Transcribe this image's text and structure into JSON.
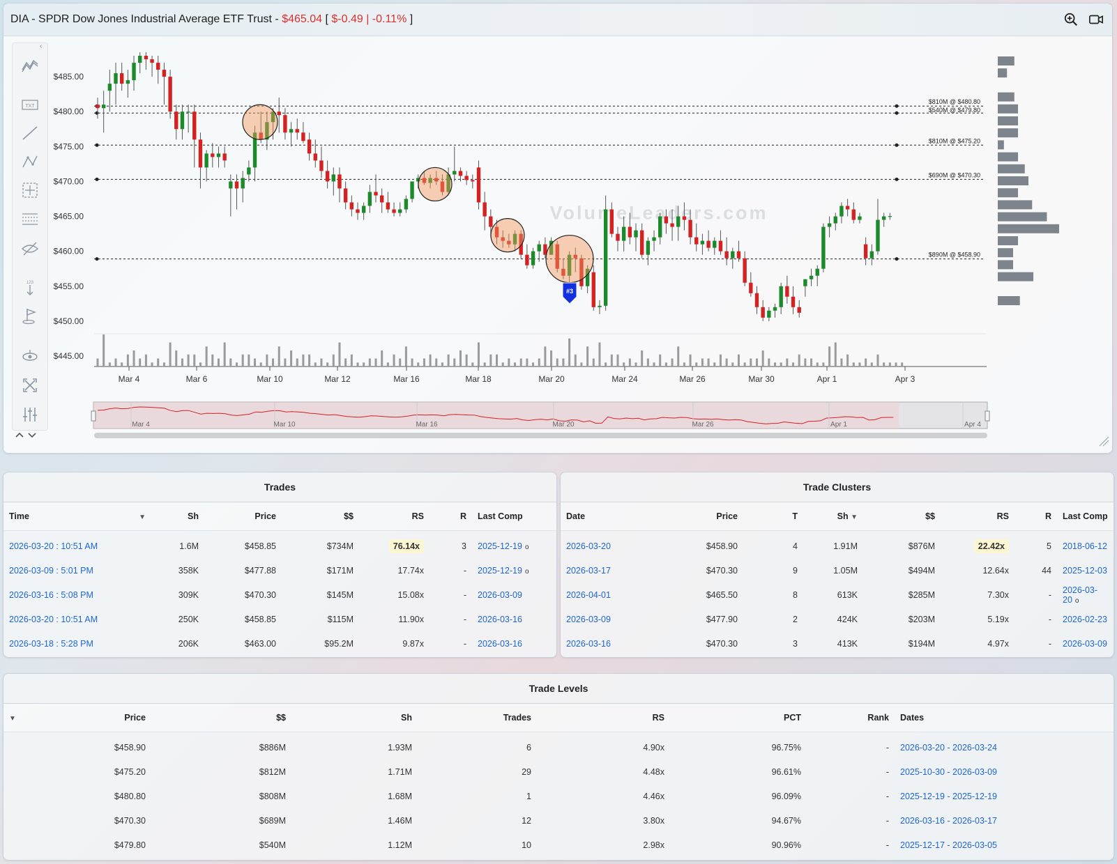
{
  "header": {
    "symbol": "DIA",
    "name_sep": " - SPDR Dow Jones Industrial Average ETF Trust - ",
    "price": "$465.04",
    "open_bracket": " [ ",
    "change": "$-0.49",
    "pipe": " | ",
    "change_pct": "-0.11%",
    "close_bracket": " ]",
    "icons": [
      "zoom-in-icon",
      "video-camera-icon"
    ]
  },
  "toolbar": {
    "tools": [
      "trend-lines-icon",
      "text-icon",
      "line-icon",
      "pattern-icon",
      "measure-icon",
      "fib-icon",
      "hide-icon",
      "price-label-icon",
      "flag-icon",
      "magnet-icon",
      "fullscreen-icon",
      "settings-icon"
    ]
  },
  "chart_data": {
    "type": "candlestick",
    "y_ticks": [
      "$485.00",
      "$480.00",
      "$475.00",
      "$470.00",
      "$465.00",
      "$460.00",
      "$455.00",
      "$450.00",
      "$445.00"
    ],
    "x_ticks": [
      "Mar 4",
      "Mar 6",
      "Mar 10",
      "Mar 12",
      "Mar 16",
      "Mar 18",
      "Mar 20",
      "Mar 24",
      "Mar 26",
      "Mar 30",
      "Apr 1",
      "Apr 3"
    ],
    "ylim": [
      443.5,
      489.5
    ],
    "watermark": "VolumeLeaders.com",
    "levels": [
      {
        "price": 480.8,
        "label": "$810M @ $480.80"
      },
      {
        "price": 479.8,
        "label": "$540M @ $479.80"
      },
      {
        "price": 475.2,
        "label": "$810M @ $475.20"
      },
      {
        "price": 470.3,
        "label": "$690M @ $470.30"
      },
      {
        "price": 458.9,
        "label": "$890M @ $458.90"
      }
    ],
    "cluster_marker": "#3",
    "navigator_ticks": [
      "Mar 4",
      "Mar 10",
      "Mar 16",
      "Mar 20",
      "Mar 26",
      "Apr 1",
      "Apr 4"
    ],
    "candles": [
      [
        481,
        482,
        479,
        480.5
      ],
      [
        480.5,
        483,
        477,
        481
      ],
      [
        483,
        486,
        480,
        484
      ],
      [
        484,
        487,
        481,
        485.5
      ],
      [
        485.5,
        487,
        483,
        484
      ],
      [
        484,
        486,
        482,
        484.5
      ],
      [
        484.5,
        488,
        483,
        487
      ],
      [
        487,
        488.5,
        485.5,
        488
      ],
      [
        488,
        488.5,
        486,
        487.5
      ],
      [
        487.5,
        488,
        485,
        487
      ],
      [
        487,
        488,
        484,
        486
      ],
      [
        486,
        487,
        481,
        485
      ],
      [
        485,
        486,
        479,
        480
      ],
      [
        480,
        481,
        476,
        477.5
      ],
      [
        477.5,
        481,
        476,
        480
      ],
      [
        480,
        481,
        477,
        480
      ],
      [
        480,
        481,
        472,
        476
      ],
      [
        476,
        477,
        469,
        472
      ],
      [
        472,
        474.5,
        470,
        474
      ],
      [
        474,
        475.5,
        472,
        473.5
      ],
      [
        473.5,
        475,
        472,
        474
      ],
      [
        474,
        475,
        472,
        473
      ],
      [
        469,
        471,
        465,
        470
      ],
      [
        470,
        471,
        466,
        469
      ],
      [
        469,
        471.5,
        467,
        470.5
      ],
      [
        471,
        473,
        470,
        472
      ],
      [
        472,
        478,
        470,
        477
      ],
      [
        477,
        480,
        475.5,
        476
      ],
      [
        476,
        480,
        474.5,
        478.5
      ],
      [
        478.5,
        480.5,
        476,
        480
      ],
      [
        480,
        482,
        477,
        479.5
      ],
      [
        479.5,
        480.5,
        476,
        477
      ],
      [
        477,
        478.5,
        475,
        477.5
      ],
      [
        477.5,
        479,
        476,
        477
      ],
      [
        477,
        478.5,
        475.5,
        475.8
      ],
      [
        476,
        477,
        473,
        474
      ],
      [
        474,
        476,
        472,
        473
      ],
      [
        473,
        475,
        470.5,
        471.5
      ],
      [
        471.5,
        473,
        469,
        470
      ],
      [
        470,
        472,
        468,
        471
      ],
      [
        471,
        472,
        467,
        469
      ],
      [
        469,
        470,
        466,
        467
      ],
      [
        467,
        468,
        465,
        466
      ],
      [
        466,
        467,
        464.5,
        465.5
      ],
      [
        465.5,
        467,
        464.5,
        466.5
      ],
      [
        466.5,
        469.5,
        465.5,
        468.5
      ],
      [
        468.5,
        471,
        467,
        468
      ],
      [
        468,
        469,
        465.5,
        467
      ],
      [
        467,
        468.5,
        465.5,
        466
      ],
      [
        466,
        467,
        465,
        465.5
      ],
      [
        465.5,
        467,
        465,
        466
      ],
      [
        466,
        468,
        465.5,
        467.5
      ],
      [
        467.5,
        470,
        467,
        470
      ],
      [
        470,
        471,
        469,
        470.5
      ],
      [
        470.5,
        471.5,
        469.5,
        469.8
      ],
      [
        469.8,
        471,
        469,
        470.5
      ],
      [
        470.5,
        471.5,
        469.5,
        470
      ],
      [
        470,
        471,
        468,
        468.5
      ],
      [
        468.5,
        472,
        468,
        471
      ],
      [
        471,
        475,
        470,
        471.5
      ],
      [
        471.5,
        472,
        470,
        470.8
      ],
      [
        470.8,
        471.5,
        469.5,
        470.2
      ],
      [
        470.2,
        471,
        469,
        470
      ],
      [
        472,
        473,
        466,
        467
      ],
      [
        467,
        468.5,
        463,
        465
      ],
      [
        465,
        466,
        462,
        463.5
      ],
      [
        463.5,
        464.5,
        461,
        462
      ],
      [
        462,
        463,
        460.5,
        461.5
      ],
      [
        461.5,
        462.5,
        460.5,
        461
      ],
      [
        461,
        463,
        460,
        462.5
      ],
      [
        462.5,
        463,
        459,
        459.5
      ],
      [
        459.5,
        461,
        457.5,
        458
      ],
      [
        458,
        460.5,
        457.5,
        460
      ],
      [
        460,
        461.5,
        458.5,
        461
      ],
      [
        461,
        462,
        459,
        459.5
      ],
      [
        459.5,
        462,
        459.5,
        461.5
      ],
      [
        461,
        461.5,
        457,
        457.5
      ],
      [
        457.5,
        459,
        456,
        456.5
      ],
      [
        456.5,
        460,
        455.5,
        459.5
      ],
      [
        459.5,
        460.5,
        457,
        459
      ],
      [
        459,
        459.5,
        454.5,
        455
      ],
      [
        455,
        458,
        454,
        457.5
      ],
      [
        457,
        458,
        451.5,
        452
      ],
      [
        452,
        453,
        451,
        452.2
      ],
      [
        452.2,
        468,
        451.5,
        466
      ],
      [
        466,
        467,
        462,
        462.5
      ],
      [
        462.5,
        463.5,
        460,
        461.5
      ],
      [
        461.5,
        465,
        460,
        463.5
      ],
      [
        463.5,
        465.5,
        461,
        462
      ],
      [
        462,
        464,
        460,
        463
      ],
      [
        463,
        464,
        459,
        459.5
      ],
      [
        459.5,
        462,
        458,
        461.5
      ],
      [
        461.5,
        463,
        460,
        462
      ],
      [
        462,
        465.5,
        461,
        465
      ],
      [
        465,
        466,
        462.5,
        464
      ],
      [
        464,
        466,
        461.5,
        463.5
      ],
      [
        463.5,
        466.5,
        461.5,
        465
      ],
      [
        465,
        467,
        463,
        464.5
      ],
      [
        464.5,
        466,
        461,
        462
      ],
      [
        462,
        464,
        460,
        461
      ],
      [
        461,
        462.5,
        459.5,
        461.5
      ],
      [
        461.5,
        463,
        460,
        460.5
      ],
      [
        460.5,
        462,
        459.5,
        461.5
      ],
      [
        461.5,
        463,
        459.5,
        460
      ],
      [
        460,
        462,
        458,
        459
      ],
      [
        459,
        460.5,
        457.5,
        460
      ],
      [
        460,
        461.5,
        458.5,
        459
      ],
      [
        459,
        460,
        455,
        455.5
      ],
      [
        455.5,
        457,
        453.5,
        454
      ],
      [
        454,
        455,
        451,
        452
      ],
      [
        452,
        453,
        450,
        450.5
      ],
      [
        450.5,
        452,
        450,
        451.5
      ],
      [
        451.5,
        452.5,
        450.5,
        452
      ],
      [
        452,
        455.5,
        451,
        455
      ],
      [
        455,
        456.5,
        452.5,
        453.5
      ],
      [
        453.5,
        455,
        451,
        452
      ],
      [
        452,
        453,
        450.5,
        451.2
      ],
      [
        455,
        456,
        453.5,
        456
      ],
      [
        456,
        457.5,
        455,
        456.5
      ],
      [
        456.5,
        458,
        455,
        457.5
      ],
      [
        457.5,
        464,
        457,
        463.5
      ],
      [
        463.5,
        465,
        462,
        464
      ],
      [
        464,
        465.5,
        463,
        465
      ],
      [
        465,
        467,
        464,
        466.5
      ],
      [
        466.5,
        467.5,
        465,
        466
      ],
      [
        466,
        467,
        464,
        464.5
      ],
      [
        464.5,
        465.5,
        464,
        465
      ],
      [
        461,
        462,
        458,
        459
      ],
      [
        459,
        461,
        458,
        460
      ],
      [
        460,
        467.5,
        459.5,
        464.5
      ],
      [
        464.5,
        465.5,
        463.5,
        465
      ],
      [
        465,
        465.5,
        464.5,
        465.04
      ]
    ],
    "volumes": [
      2,
      8,
      1,
      2,
      1,
      3,
      4,
      2,
      3,
      1,
      2,
      1,
      6,
      4,
      2,
      3,
      3,
      1,
      5,
      3,
      2,
      6,
      2,
      1,
      3,
      3,
      2,
      1,
      3,
      2,
      5,
      2,
      4,
      2,
      3,
      3,
      1,
      2,
      1,
      3,
      6,
      2,
      3,
      1,
      1,
      2,
      2,
      4,
      1,
      3,
      2,
      5,
      2,
      1,
      2,
      3,
      2,
      1,
      3,
      2,
      4,
      3,
      1,
      6,
      1,
      3,
      3,
      1,
      2,
      1,
      2,
      2,
      1,
      2,
      5,
      4,
      2,
      2,
      7,
      3,
      1,
      5,
      2,
      6,
      1,
      3,
      3,
      1,
      2,
      1,
      4,
      2,
      1,
      3,
      1,
      2,
      5,
      1,
      3,
      1,
      2,
      2,
      1,
      3,
      2,
      1,
      3,
      1,
      2,
      2,
      4,
      2,
      1,
      1,
      2,
      1,
      3,
      2,
      2,
      1,
      1,
      5,
      6,
      2,
      3,
      1,
      1,
      2,
      1,
      3,
      1,
      1,
      1,
      1
    ]
  },
  "volume_profile": [
    0.27,
    0.15,
    0.0,
    0.27,
    0.33,
    0.33,
    0.33,
    0.1,
    0.33,
    0.44,
    0.5,
    0.33,
    0.56,
    0.8,
    1.0,
    0.33,
    0.25,
    0.25,
    0.58,
    0.0,
    0.36
  ],
  "trades": {
    "title": "Trades",
    "columns": [
      "Time",
      "Sh",
      "Price",
      "$$",
      "RS",
      "R",
      "Last Comp"
    ],
    "rows": [
      {
        "time": "2026-03-20 : 10:51 AM",
        "sh": "1.6M",
        "price": "$458.85",
        "dollars": "$734M",
        "rs": "76.14x",
        "r": "3",
        "last": "2025-12-19",
        "dot": "o"
      },
      {
        "time": "2026-03-09 : 5:01 PM",
        "sh": "358K",
        "price": "$477.88",
        "dollars": "$171M",
        "rs": "17.74x",
        "r": "-",
        "last": "2025-12-19",
        "dot": "o"
      },
      {
        "time": "2026-03-16 : 5:08 PM",
        "sh": "309K",
        "price": "$470.30",
        "dollars": "$145M",
        "rs": "15.08x",
        "r": "-",
        "last": "2026-03-09",
        "dot": ""
      },
      {
        "time": "2026-03-20 : 10:51 AM",
        "sh": "250K",
        "price": "$458.85",
        "dollars": "$115M",
        "rs": "11.90x",
        "r": "-",
        "last": "2026-03-16",
        "dot": ""
      },
      {
        "time": "2026-03-18 : 5:28 PM",
        "sh": "206K",
        "price": "$463.00",
        "dollars": "$95.2M",
        "rs": "9.87x",
        "r": "-",
        "last": "2026-03-16",
        "dot": ""
      }
    ]
  },
  "clusters": {
    "title": "Trade Clusters",
    "columns": [
      "Date",
      "Price",
      "T",
      "Sh",
      "$$",
      "RS",
      "R",
      "Last Comp"
    ],
    "rows": [
      {
        "date": "2026-03-20",
        "price": "$458.90",
        "t": "4",
        "sh": "1.91M",
        "dollars": "$876M",
        "rs": "22.42x",
        "r": "5",
        "last": "2018-06-12",
        "dot": ""
      },
      {
        "date": "2026-03-17",
        "price": "$470.30",
        "t": "9",
        "sh": "1.05M",
        "dollars": "$494M",
        "rs": "12.64x",
        "r": "44",
        "last": "2025-12-03",
        "dot": ""
      },
      {
        "date": "2026-04-01",
        "price": "$465.50",
        "t": "8",
        "sh": "613K",
        "dollars": "$285M",
        "rs": "7.30x",
        "r": "-",
        "last": "2026-03-20",
        "dot": "o"
      },
      {
        "date": "2026-03-09",
        "price": "$477.90",
        "t": "2",
        "sh": "424K",
        "dollars": "$203M",
        "rs": "5.19x",
        "r": "-",
        "last": "2026-02-23",
        "dot": ""
      },
      {
        "date": "2026-03-16",
        "price": "$470.30",
        "t": "3",
        "sh": "413K",
        "dollars": "$194M",
        "rs": "4.97x",
        "r": "-",
        "last": "2026-03-09",
        "dot": ""
      }
    ]
  },
  "levels": {
    "title": "Trade Levels",
    "columns": [
      "Price",
      "$$",
      "Sh",
      "Trades",
      "RS",
      "PCT",
      "Rank",
      "Dates"
    ],
    "rows": [
      {
        "price": "$458.90",
        "dollars": "$886M",
        "sh": "1.93M",
        "trades": "6",
        "rs": "4.90x",
        "pct": "96.75%",
        "rank": "-",
        "dates": "2026-03-20 - 2026-03-24"
      },
      {
        "price": "$475.20",
        "dollars": "$812M",
        "sh": "1.71M",
        "trades": "29",
        "rs": "4.48x",
        "pct": "96.61%",
        "rank": "-",
        "dates": "2025-10-30 - 2026-03-09"
      },
      {
        "price": "$480.80",
        "dollars": "$808M",
        "sh": "1.68M",
        "trades": "1",
        "rs": "4.46x",
        "pct": "96.09%",
        "rank": "-",
        "dates": "2025-12-19 - 2025-12-19"
      },
      {
        "price": "$470.30",
        "dollars": "$689M",
        "sh": "1.46M",
        "trades": "12",
        "rs": "3.80x",
        "pct": "94.67%",
        "rank": "-",
        "dates": "2026-03-16 - 2026-03-17"
      },
      {
        "price": "$479.80",
        "dollars": "$540M",
        "sh": "1.12M",
        "trades": "10",
        "rs": "2.98x",
        "pct": "90.96%",
        "rank": "-",
        "dates": "2025-12-17 - 2026-03-05"
      }
    ]
  }
}
